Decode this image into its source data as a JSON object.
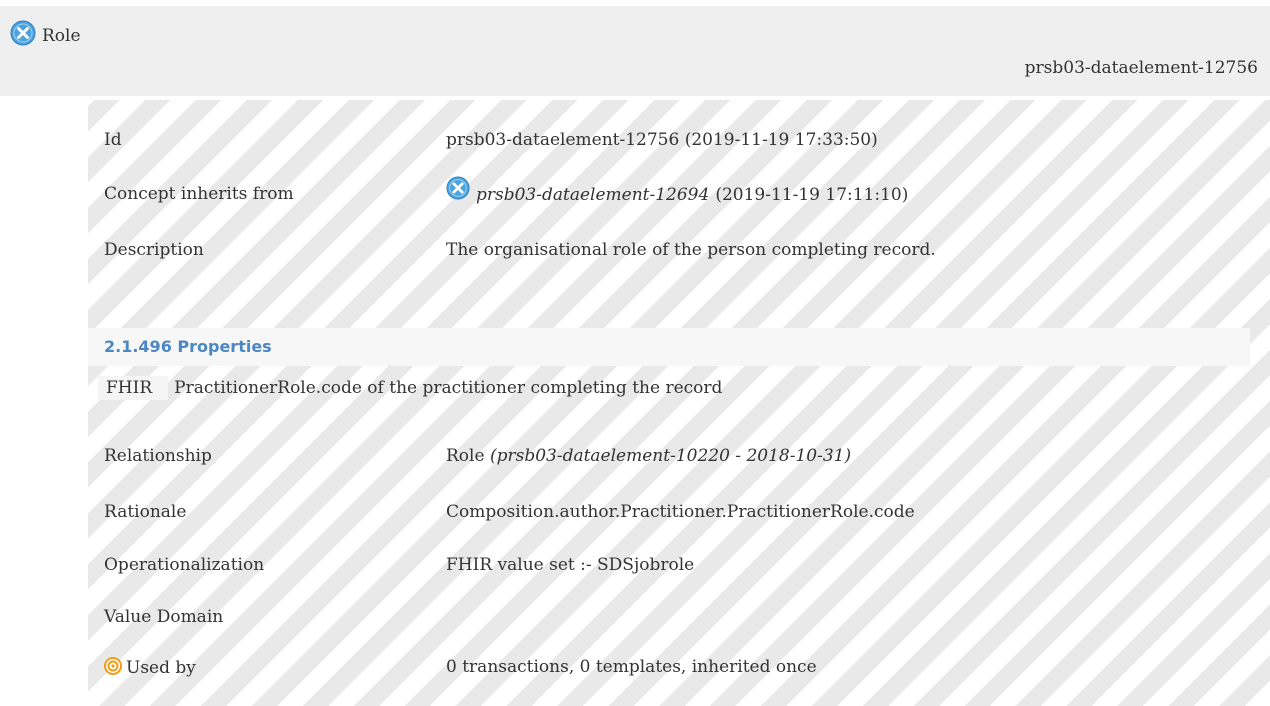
{
  "header": {
    "title": "Role",
    "id": "prsb03-dataelement-12756",
    "icon": "concept-x-icon",
    "icon_color": "#4aa3df"
  },
  "details": {
    "id": {
      "label": "Id",
      "value": "prsb03-dataelement-12756 (2019-11-19 17:33:50)"
    },
    "inherits": {
      "label": "Concept inherits from",
      "ref": "prsb03-dataelement-12694",
      "date": "(2019-11-19 17:11:10)"
    },
    "description": {
      "label": "Description",
      "value": "The organisational role of the person completing record."
    }
  },
  "properties": {
    "title": "2.1.496 Properties",
    "title_color": "#4b87c2",
    "fhir_tag": "FHIR",
    "fhir_text": "PractitionerRole.code of the practitioner completing the record"
  },
  "meta": {
    "relationship": {
      "label": "Relationship",
      "value": "Role",
      "ref": "(prsb03-dataelement-10220 - 2018-10-31)"
    },
    "rationale": {
      "label": "Rationale",
      "value": "Composition.author.Practitioner.PractitionerRole.code"
    },
    "operationalization": {
      "label": "Operationalization",
      "value": "FHIR value set :- SDSjobrole"
    },
    "value_domain": {
      "label": "Value Domain",
      "value": ""
    },
    "used_by": {
      "label": "Used by",
      "value": "0 transactions, 0 templates, inherited once",
      "icon": "target-icon",
      "icon_color": "#f39c12"
    }
  }
}
